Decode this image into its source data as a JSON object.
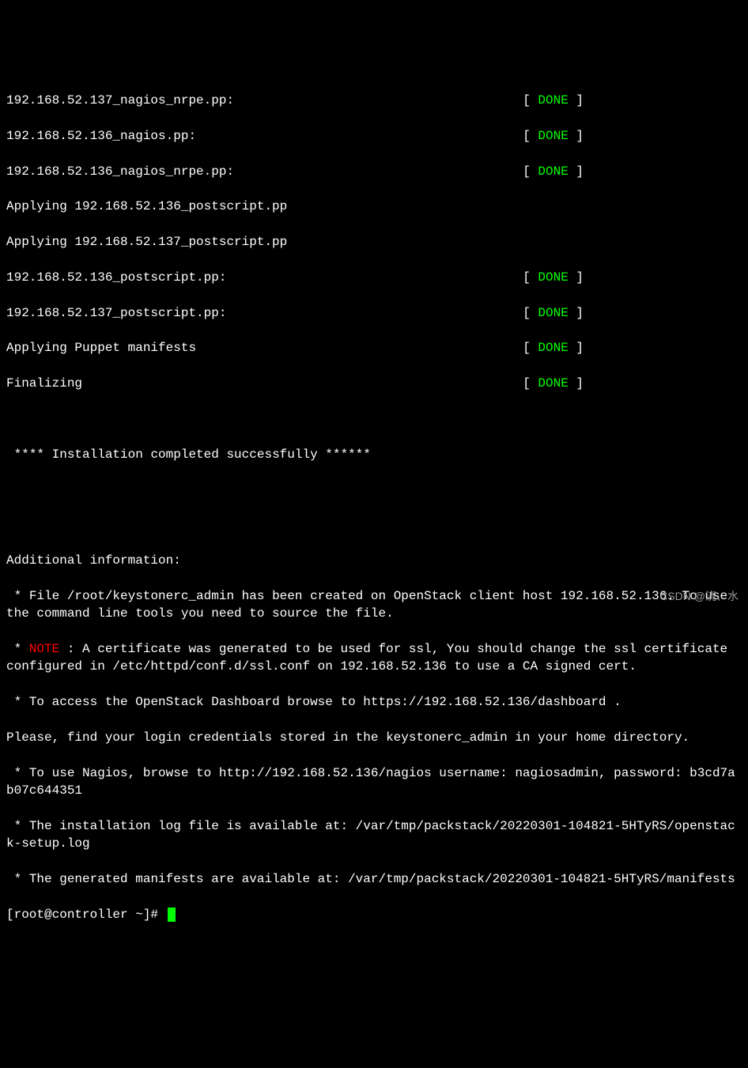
{
  "status_lines": [
    {
      "task": "192.168.52.137_nagios_nrpe.pp:",
      "status": "DONE"
    },
    {
      "task": "192.168.52.136_nagios.pp:",
      "status": "DONE"
    },
    {
      "task": "192.168.52.136_nagios_nrpe.pp:",
      "status": "DONE"
    }
  ],
  "apply_lines": [
    "Applying 192.168.52.136_postscript.pp",
    "Applying 192.168.52.137_postscript.pp"
  ],
  "status_lines2": [
    {
      "task": "192.168.52.136_postscript.pp:",
      "status": "DONE"
    },
    {
      "task": "192.168.52.137_postscript.pp:",
      "status": "DONE"
    },
    {
      "task": "Applying Puppet manifests",
      "status": "DONE"
    },
    {
      "task": "Finalizing",
      "status": "DONE"
    }
  ],
  "success_line": " **** Installation completed successfully ******",
  "additional_header": "Additional information:",
  "info_file": " * File /root/keystonerc_admin has been created on OpenStack client host 192.168.52.136. To use the command line tools you need to source the file.",
  "note_prefix": " * ",
  "note_word": "NOTE",
  "note_rest": " : A certificate was generated to be used for ssl, You should change the ssl certificate configured in /etc/httpd/conf.d/ssl.conf on 192.168.52.136 to use a CA signed cert.",
  "info_dashboard": " * To access the OpenStack Dashboard browse to https://192.168.52.136/dashboard .",
  "info_creds": "Please, find your login credentials stored in the keystonerc_admin in your home directory.",
  "info_nagios": " * To use Nagios, browse to http://192.168.52.136/nagios username: nagiosadmin, password: b3cd7ab07c644351",
  "info_log": " * The installation log file is available at: /var/tmp/packstack/20220301-104821-5HTyRS/openstack-setup.log",
  "info_manifests": " * The generated manifests are available at: /var/tmp/packstack/20220301-104821-5HTyRS/manifests",
  "prompt": "[root@controller ~]# ",
  "watermark": "CSDN @浇、水"
}
